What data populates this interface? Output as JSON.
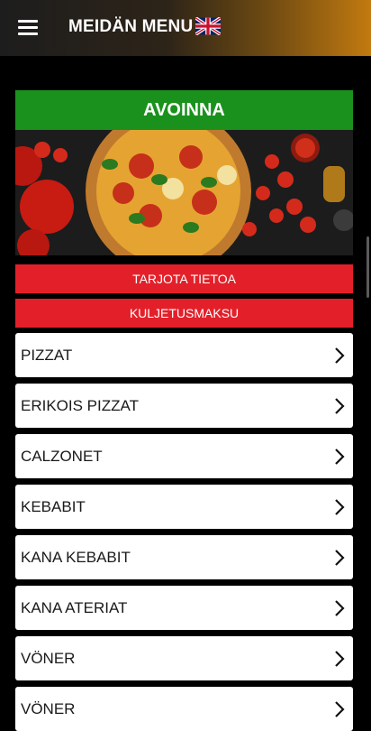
{
  "header": {
    "title": "MEIDÄN MENU",
    "menu_icon": "hamburger-menu-icon",
    "language_icon": "uk-flag-icon"
  },
  "status": {
    "label": "AVOINNA",
    "color": "#19911c"
  },
  "hero": {
    "image": "pizza-banner"
  },
  "buttons": {
    "info_label": "TARJOTA TIETOA",
    "delivery_label": "KULJETUSMAKSU",
    "color": "#e3202a"
  },
  "categories": [
    {
      "label": "PIZZAT"
    },
    {
      "label": "ERIKOIS PIZZAT"
    },
    {
      "label": "CALZONET"
    },
    {
      "label": "KEBABIT"
    },
    {
      "label": "KANA KEBABIT"
    },
    {
      "label": "KANA ATERIAT"
    },
    {
      "label": "VÖNER"
    },
    {
      "label": "VÖNER"
    }
  ],
  "colors": {
    "accent": "#c27a10",
    "background": "#000000"
  }
}
